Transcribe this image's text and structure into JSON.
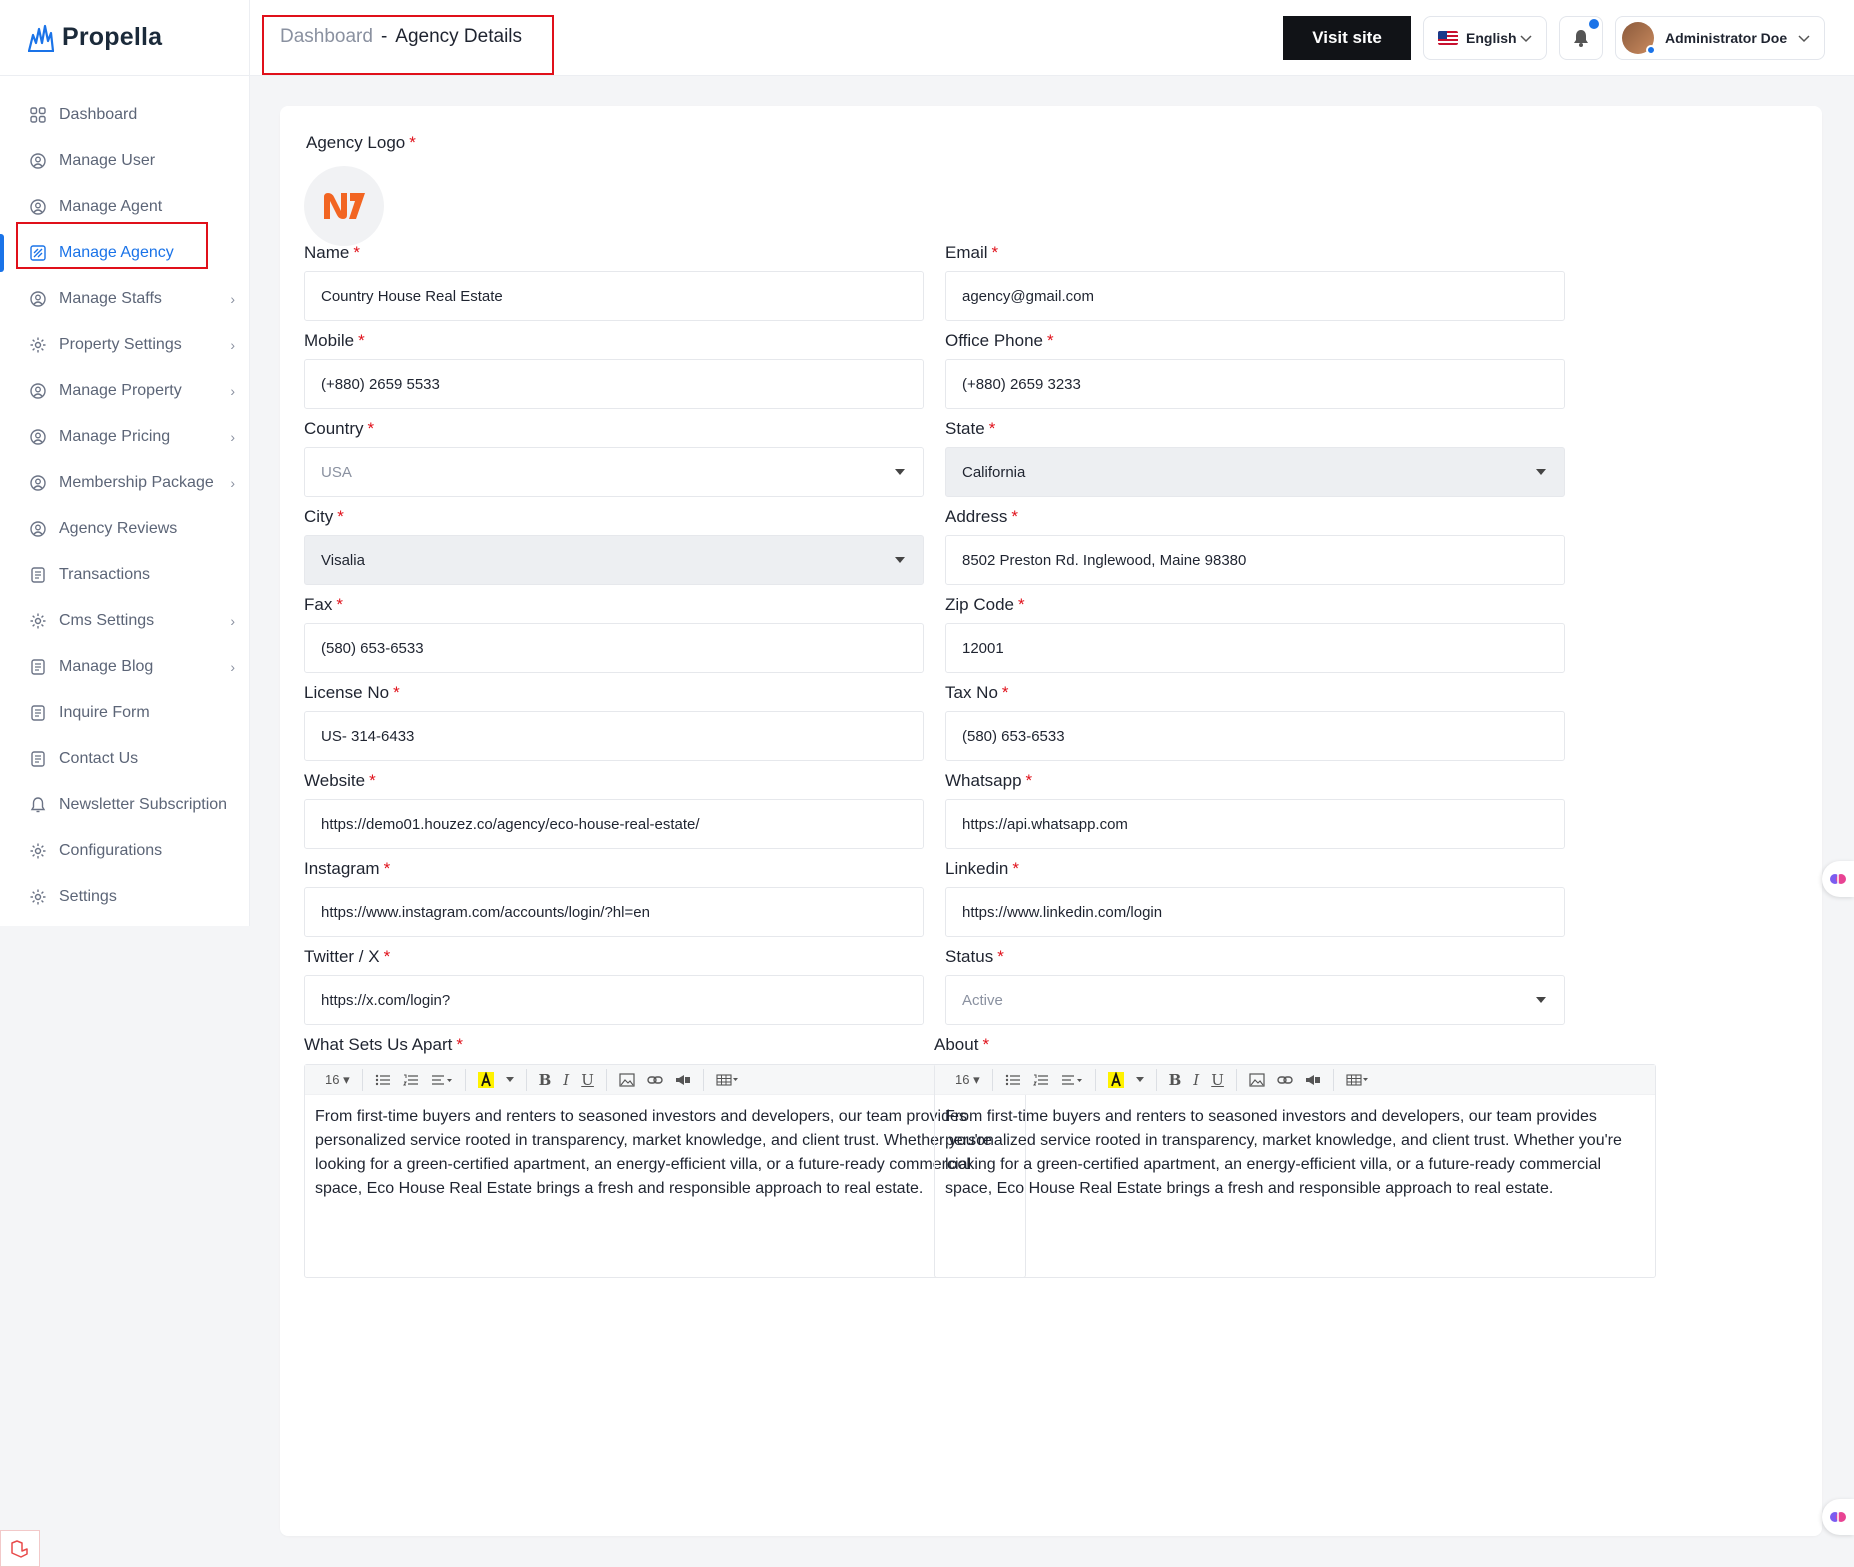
{
  "brand": {
    "name": "Propella"
  },
  "breadcrumb": {
    "parent": "Dashboard",
    "separator": "-",
    "current": "Agency Details"
  },
  "topbar": {
    "visit_label": "Visit site",
    "language": "English",
    "user_name": "Administrator Doe"
  },
  "sidebar": {
    "items": [
      {
        "label": "Dashboard",
        "icon": "grid-icon"
      },
      {
        "label": "Manage User",
        "icon": "user-circle-icon"
      },
      {
        "label": "Manage Agent",
        "icon": "agent-icon"
      },
      {
        "label": "Manage Agency",
        "icon": "agency-icon"
      },
      {
        "label": "Manage Staffs",
        "icon": "users-icon"
      },
      {
        "label": "Property Settings",
        "icon": "home-gear-icon"
      },
      {
        "label": "Manage Property",
        "icon": "property-icon"
      },
      {
        "label": "Manage Pricing",
        "icon": "dollar-icon"
      },
      {
        "label": "Membership Package",
        "icon": "membership-icon"
      },
      {
        "label": "Agency Reviews",
        "icon": "review-icon"
      },
      {
        "label": "Transactions",
        "icon": "receipt-icon"
      },
      {
        "label": "Cms Settings",
        "icon": "cms-gear-icon"
      },
      {
        "label": "Manage Blog",
        "icon": "blog-icon"
      },
      {
        "label": "Inquire Form",
        "icon": "form-icon"
      },
      {
        "label": "Contact Us",
        "icon": "contact-icon"
      },
      {
        "label": "Newsletter Subscription",
        "icon": "bell-icon"
      },
      {
        "label": "Configurations",
        "icon": "config-gear-icon"
      },
      {
        "label": "Settings",
        "icon": "settings-gear-icon"
      }
    ]
  },
  "form": {
    "logo_label": "Agency Logo",
    "name": {
      "label": "Name",
      "value": "Country House Real Estate"
    },
    "email": {
      "label": "Email",
      "value": "agency@gmail.com"
    },
    "mobile": {
      "label": "Mobile",
      "value": "(+880) 2659 5533"
    },
    "office_phone": {
      "label": "Office Phone",
      "value": "(+880) 2659 3233"
    },
    "country": {
      "label": "Country",
      "value": "USA"
    },
    "state": {
      "label": "State",
      "value": "California"
    },
    "city": {
      "label": "City",
      "value": "Visalia"
    },
    "address": {
      "label": "Address",
      "value": "8502 Preston Rd. Inglewood, Maine 98380"
    },
    "fax": {
      "label": "Fax",
      "value": "(580) 653-6533"
    },
    "zip": {
      "label": "Zip Code",
      "value": "12001"
    },
    "license": {
      "label": "License No",
      "value": "US- 314-6433"
    },
    "tax": {
      "label": "Tax No",
      "value": "(580) 653-6533"
    },
    "website": {
      "label": "Website",
      "value": "https://demo01.houzez.co/agency/eco-house-real-estate/"
    },
    "whatsapp": {
      "label": "Whatsapp",
      "value": "https://api.whatsapp.com"
    },
    "instagram": {
      "label": "Instagram",
      "value": "https://www.instagram.com/accounts/login/?hl=en"
    },
    "linkedin": {
      "label": "Linkedin",
      "value": "https://www.linkedin.com/login"
    },
    "twitter": {
      "label": "Twitter / X",
      "value": "https://x.com/login?"
    },
    "status": {
      "label": "Status",
      "value": "Active"
    },
    "apart": {
      "label": "What Sets Us Apart",
      "font_size": "16",
      "text": "From first-time buyers and renters to seasoned investors and developers, our team provides personalized service rooted in transparency, market knowledge, and client trust. Whether you're looking for a green-certified apartment, an energy-efficient villa, or a future-ready commercial space, Eco House Real Estate brings a fresh and responsible approach to real estate."
    },
    "about": {
      "label": "About",
      "font_size": "16",
      "text": "From first-time buyers and renters to seasoned investors and developers, our team provides personalized service rooted in transparency, market knowledge, and client trust. Whether you're looking for a green-certified apartment, an energy-efficient villa, or a future-ready commercial space, Eco House Real Estate brings a fresh and responsible approach to real estate."
    },
    "required_mark": "*"
  },
  "colors": {
    "accent": "#1a73e8",
    "highlight": "#e0101a",
    "logo_orange": "#f26522"
  }
}
